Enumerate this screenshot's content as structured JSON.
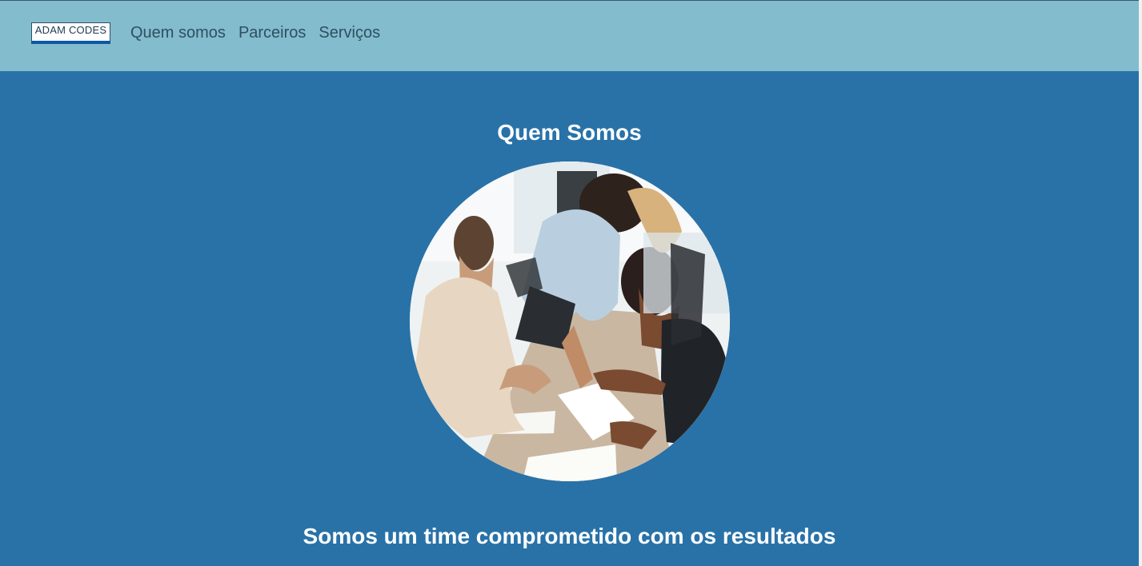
{
  "header": {
    "logo_text": "ADAM CODES",
    "nav": [
      {
        "label": "Quem somos"
      },
      {
        "label": "Parceiros"
      },
      {
        "label": "Serviços"
      }
    ]
  },
  "main": {
    "title": "Quem Somos",
    "tagline": "Somos um time comprometido com os resultados"
  },
  "colors": {
    "header_background": "#82bccd",
    "page_background": "#2872a8",
    "text_white": "#ffffff",
    "nav_text": "#2e4f62"
  }
}
